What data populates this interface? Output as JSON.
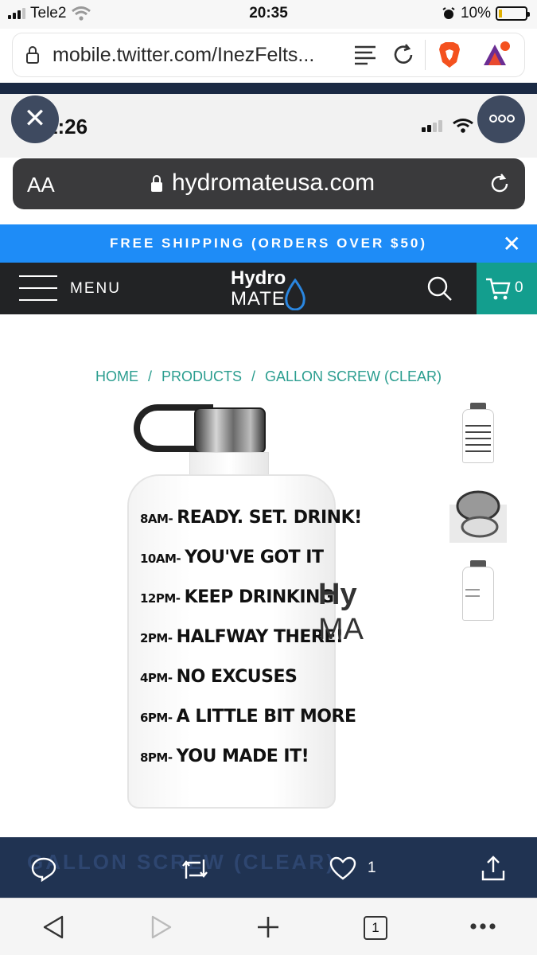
{
  "status_bar": {
    "carrier": "Tele2",
    "time": "20:35",
    "battery": "10%"
  },
  "browser": {
    "url": "mobile.twitter.com/InezFelts..."
  },
  "overlay": {
    "close_label": "✕"
  },
  "inner_screenshot": {
    "status": {
      "time": "1:26"
    },
    "url_bar": {
      "text_size_label": "AA",
      "domain": "hydromateusa.com"
    },
    "promo": {
      "text": "FREE SHIPPING (ORDERS OVER $50)",
      "close": "✕"
    },
    "header": {
      "menu_label": "MENU",
      "logo_top": "Hydro",
      "logo_bottom": "MATE",
      "cart_count": "0"
    },
    "breadcrumb": {
      "home": "HOME",
      "sep1": "/",
      "products": "PRODUCTS",
      "sep2": "/",
      "current": "GALLON SCREW (CLEAR)"
    },
    "bottle_schedule": [
      {
        "time": "8AM-",
        "msg": "READY. SET. DRINK!"
      },
      {
        "time": "10AM-",
        "msg": "YOU'VE GOT IT"
      },
      {
        "time": "12PM-",
        "msg": "KEEP DRINKING"
      },
      {
        "time": "2PM-",
        "msg": "HALFWAY THERE!"
      },
      {
        "time": "4PM-",
        "msg": "NO EXCUSES"
      },
      {
        "time": "6PM-",
        "msg": "A LITTLE BIT MORE"
      },
      {
        "time": "8PM-",
        "msg": "YOU MADE IT!"
      }
    ],
    "bottle_brand": {
      "top": "Hy",
      "bottom": "MA"
    },
    "product_title": "GALLON SCREW (CLEAR)"
  },
  "tweet_actions": {
    "like_count": "1"
  },
  "toolbar": {
    "tab_count": "1"
  },
  "colors": {
    "promo_blue": "#1e8cf7",
    "header_dark": "#222325",
    "cart_teal": "#139e8e",
    "breadcrumb_teal": "#2a9d8f",
    "navy": "#203352"
  }
}
